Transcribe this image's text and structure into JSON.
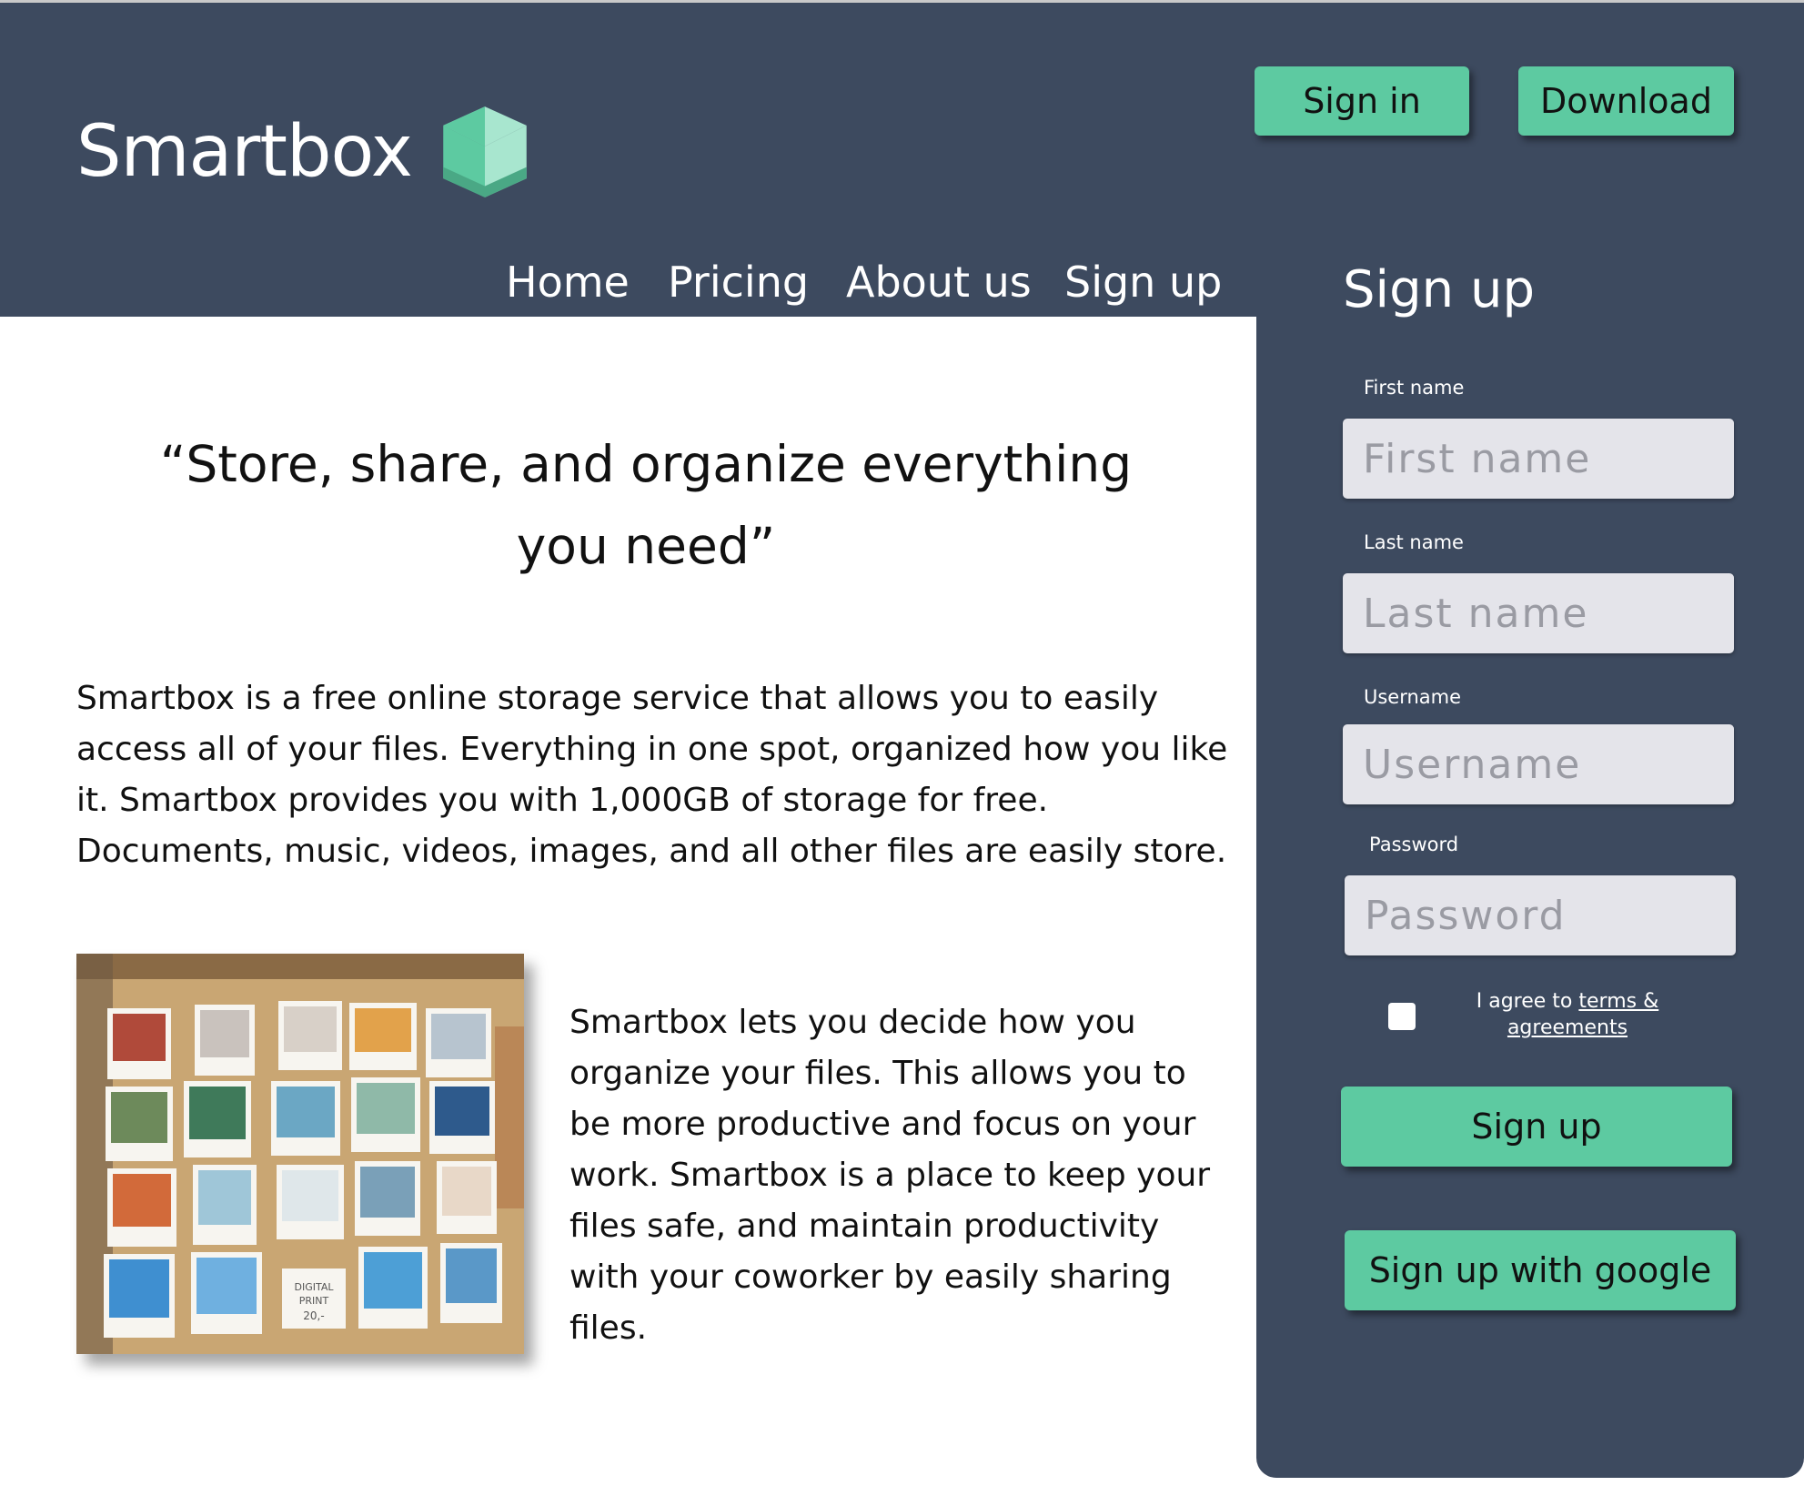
{
  "header": {
    "logo_text": "Smartbox",
    "logo_icon": "cube-icon",
    "sign_in_label": "Sign in",
    "download_label": "Download",
    "nav": [
      {
        "label": "Home"
      },
      {
        "label": "Pricing"
      },
      {
        "label": "About us"
      },
      {
        "label": "Sign up"
      }
    ]
  },
  "main": {
    "quote": "“Store, share, and organize everything you need”",
    "paragraph1": "Smartbox is a free online storage service that allows you to easily access all of your files. Everything in one spot, organized how you like it. Smartbox provides you with 1,000GB of storage for free. Documents, music, videos, images, and all other files are easily store.",
    "paragraph2": "Smartbox lets you decide how you organize your files. This allows you to be more productive and focus on your work. Smartbox is a place to keep your files safe, and maintain productivity with your coworker by easily sharing files.",
    "photo": {
      "print_label_line1": "DIGITAL",
      "print_label_line2": "PRINT",
      "print_label_line3": "20,-"
    }
  },
  "signup": {
    "title": "Sign up",
    "fields": [
      {
        "label": "First name",
        "placeholder": "First name"
      },
      {
        "label": "Last name",
        "placeholder": "Last name"
      },
      {
        "label": "Username",
        "placeholder": "Username"
      },
      {
        "label": "Password",
        "placeholder": "Password"
      }
    ],
    "agree_prefix": "I agree to ",
    "agree_link": "terms & agreements",
    "signup_button": "Sign up",
    "google_button": "Sign up with google"
  },
  "colors": {
    "header_bg": "#3d4a5f",
    "accent": "#5dcaa1",
    "input_bg": "#e4e4ea"
  }
}
